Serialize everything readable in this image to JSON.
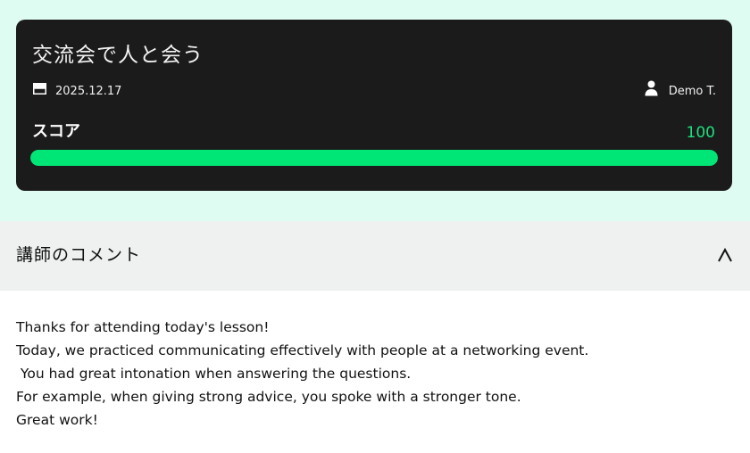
{
  "lesson": {
    "title": "交流会で人と会う",
    "date": "2025.12.17",
    "teacher": "Demo T.",
    "score_label": "スコア",
    "score_value": "100",
    "score_fraction": 1.0,
    "icons": {
      "date": "calendar-icon",
      "teacher": "person-icon"
    },
    "colors": {
      "card_background": "#1b1b1b",
      "score_accent": "#00e676",
      "page_background": "#dffcf3"
    }
  },
  "comments": {
    "title": "講師のコメント",
    "toggle_icon": "chevron-up-icon",
    "lines": [
      "Thanks for attending today's lesson!",
      "Today, we practiced communicating effectively with people at a networking event.",
      " You had great intonation when answering the questions.",
      "For example, when giving strong advice, you spoke with a stronger tone.",
      "Great work!"
    ]
  }
}
